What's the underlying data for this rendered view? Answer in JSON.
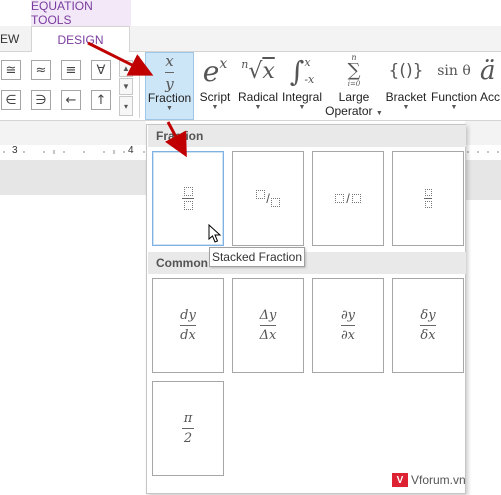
{
  "header": {
    "equation_tools": "EQUATION TOOLS",
    "tab_view_partial": "EW",
    "tab_design": "DESIGN"
  },
  "symbols": {
    "row1": [
      "≅",
      "≈",
      "≡",
      "∀"
    ],
    "row2": [
      "∈",
      "∋",
      "←",
      "↑"
    ]
  },
  "structures": [
    {
      "label": "Fraction"
    },
    {
      "label": "Script"
    },
    {
      "label": "Radical"
    },
    {
      "label": "Integral"
    },
    {
      "label": "Large",
      "label2": "Operator"
    },
    {
      "label": "Bracket"
    },
    {
      "label": "Function"
    },
    {
      "label": "Acc"
    }
  ],
  "icons": {
    "script_base": "e",
    "script_sup": "x",
    "radical_index": "n",
    "radical_arg": "x",
    "integral_upper": "x",
    "integral_lower": "-x",
    "sum_upper": "n",
    "sum_lower": "i=0",
    "bracket": "{()}",
    "function": "sin θ",
    "fraction_num": "x",
    "fraction_den": "y"
  },
  "ruler": {
    "mark3": "3",
    "mark4": "4"
  },
  "gallery": {
    "fraction_header": "Fraction",
    "common_header": "Common",
    "common": [
      {
        "num": "dy",
        "den": "dx"
      },
      {
        "num": "Δy",
        "den": "Δx"
      },
      {
        "num": "∂y",
        "den": "∂x"
      },
      {
        "num": "δy",
        "den": "δx"
      },
      {
        "num": "π",
        "den": "2"
      }
    ]
  },
  "tooltip": "Stacked Fraction",
  "watermark": "Vforum.vn",
  "colors": {
    "accent": "#7a3c9e",
    "selected": "#cde6f7",
    "arrow": "#c00000"
  }
}
